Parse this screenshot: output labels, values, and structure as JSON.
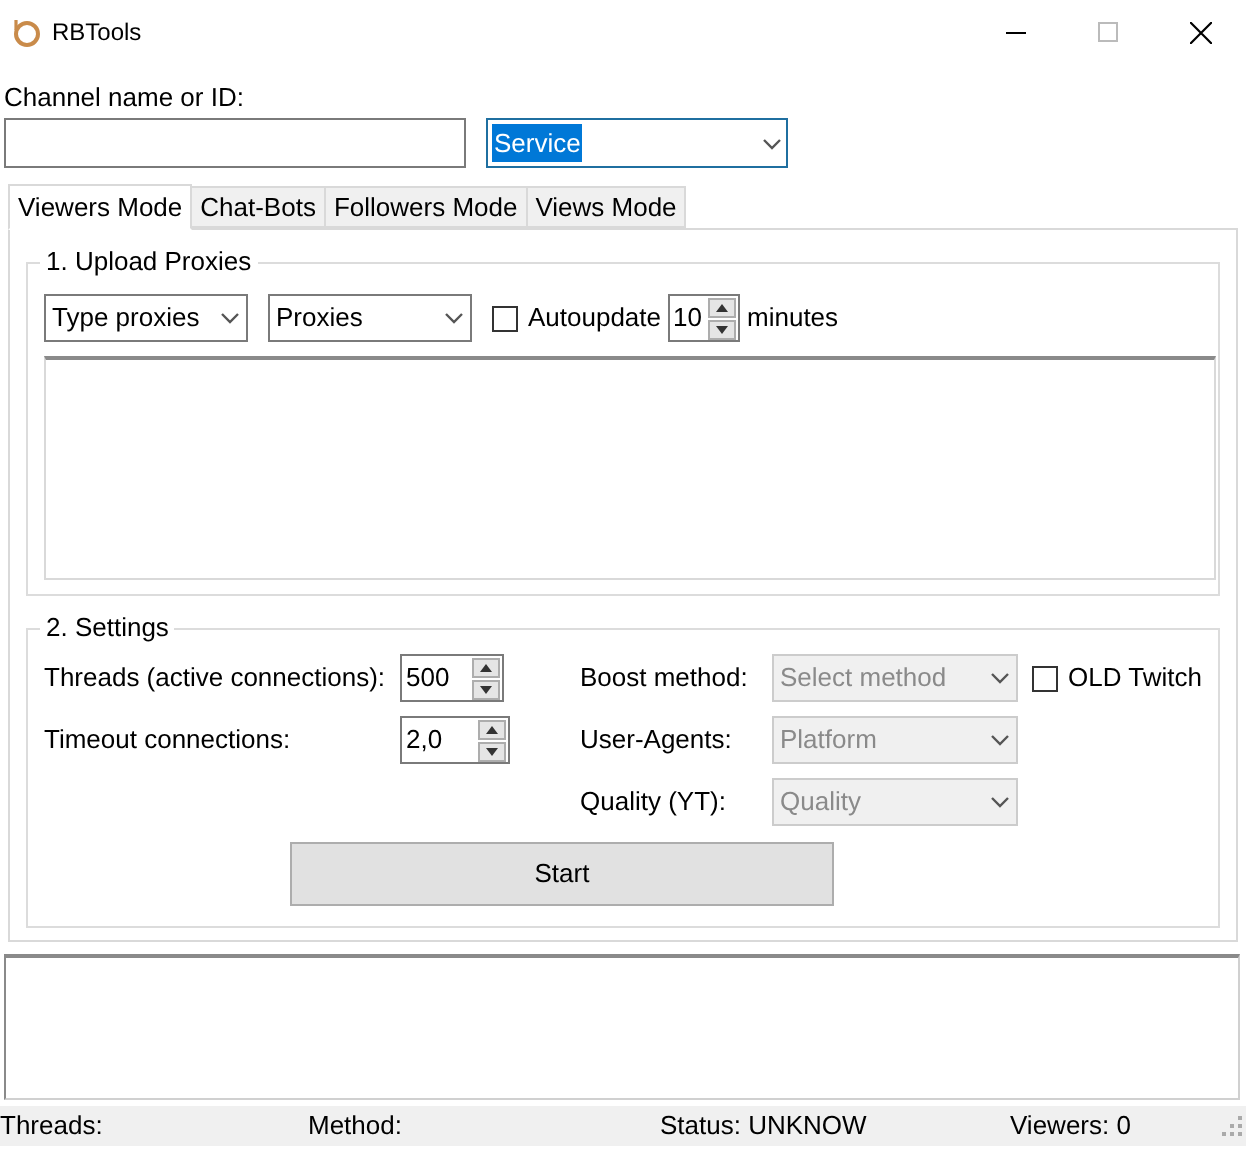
{
  "window": {
    "title": "RBTools"
  },
  "channel": {
    "label": "Channel name or ID:"
  },
  "service_select": {
    "value": "Service",
    "focused": true
  },
  "tabs": [
    {
      "label": "Viewers Mode",
      "selected": true
    },
    {
      "label": "Chat-Bots",
      "selected": false
    },
    {
      "label": "Followers Mode",
      "selected": false
    },
    {
      "label": "Views Mode",
      "selected": false
    }
  ],
  "upload_proxies": {
    "title": "1. Upload Proxies",
    "type_select": "Type proxies",
    "proxies_select": "Proxies",
    "autoupdate": {
      "label": "Autoupdate",
      "checked": false,
      "value": "10",
      "unit": "minutes"
    }
  },
  "settings": {
    "title": "2. Settings",
    "threads": {
      "label": "Threads (active connections):",
      "value": "500"
    },
    "timeout": {
      "label": "Timeout connections:",
      "value": "2,0"
    },
    "selects": [
      {
        "label": "Boost method:",
        "value": "Select method",
        "disabled": true
      },
      {
        "label": "User-Agents:",
        "value": "Platform",
        "disabled": true
      },
      {
        "label": "Quality (YT):",
        "value": "Quality",
        "disabled": true
      }
    ],
    "old_twitch": {
      "label": "OLD Twitch",
      "checked": false
    },
    "start_button": "Start"
  },
  "status_bar": [
    "Threads:",
    "Method:",
    "Status: UNKNOW",
    "Viewers: 0"
  ]
}
